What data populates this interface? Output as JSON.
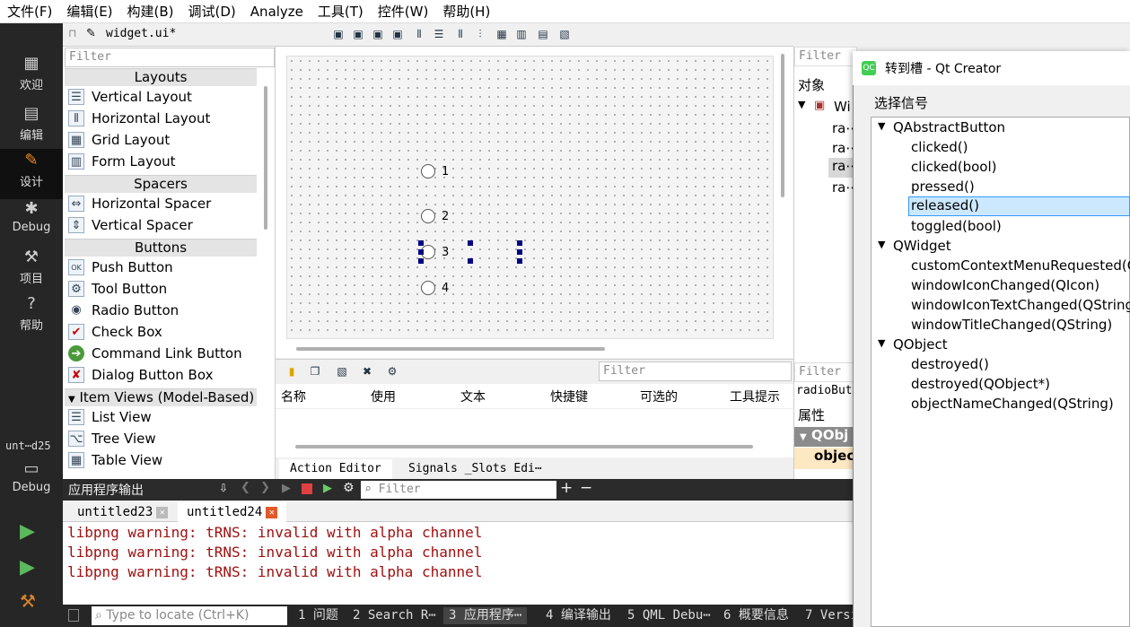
{
  "menubar": [
    "文件(F)",
    "编辑(E)",
    "构建(B)",
    "调试(D)",
    "Analyze",
    "工具(T)",
    "控件(W)",
    "帮助(H)"
  ],
  "modes": {
    "welcome": "欢迎",
    "edit": "编辑",
    "design": "设计",
    "debug": "Debug",
    "projects": "项目",
    "help": "帮助"
  },
  "kit": {
    "label": "unt⋯d25",
    "mode": "Debug"
  },
  "editor": {
    "file": "widget.ui*"
  },
  "widgetbox": {
    "filter": "Filter",
    "cat_layouts": "Layouts",
    "layouts": [
      "Vertical Layout",
      "Horizontal Layout",
      "Grid Layout",
      "Form Layout"
    ],
    "cat_spacers": "Spacers",
    "spacers": [
      "Horizontal Spacer",
      "Vertical Spacer"
    ],
    "cat_buttons": "Buttons",
    "buttons": [
      "Push Button",
      "Tool Button",
      "Radio Button",
      "Check Box",
      "Command Link Button",
      "Dialog Button Box"
    ],
    "cat_itemviews": "Item Views (Model-Based)",
    "itemviews": [
      "List View",
      "Tree View",
      "Table View"
    ]
  },
  "form": {
    "radios": [
      "1",
      "2",
      "3",
      "4"
    ]
  },
  "actions": {
    "filter": "Filter",
    "columns": [
      "名称",
      "使用",
      "文本",
      "快捷键",
      "可选的",
      "工具提示"
    ],
    "tab_action": "Action Editor",
    "tab_signals": "Signals _Slots Edi⋯"
  },
  "objinspector": {
    "filter": "Filter",
    "header": "对象",
    "root": "Wi",
    "children": [
      "ra⋯",
      "ra⋯",
      "ra⋯",
      "ra⋯"
    ]
  },
  "propeditor": {
    "filter": "Filter",
    "current": "radioButt",
    "header": "属性",
    "group": "QObj",
    "row": "object"
  },
  "output": {
    "title": "应用程序输出",
    "filter": "Filter",
    "tabs": [
      "untitled23",
      "untitled24"
    ],
    "lines": [
      "libpng warning: tRNS: invalid with alpha channel",
      "libpng warning: tRNS: invalid with alpha channel",
      "libpng warning: tRNS: invalid with alpha channel"
    ]
  },
  "statusbar": {
    "locate": "Type to locate (Ctrl+K)",
    "items": [
      "1 问题",
      "2 Search R⋯",
      "3 应用程序⋯",
      "4 编译输出",
      "5 QML Debu⋯",
      "6 概要信息",
      "7 Versi"
    ]
  },
  "dialog": {
    "title": "转到槽 - Qt Creator",
    "group": "选择信号",
    "classes": [
      {
        "name": "QAbstractButton",
        "signals": [
          "clicked()",
          "clicked(bool)",
          "pressed()",
          "released()",
          "toggled(bool)"
        ]
      },
      {
        "name": "QWidget",
        "signals": [
          "customContextMenuRequested(Q",
          "windowIconChanged(QIcon)",
          "windowIconTextChanged(QString)",
          "windowTitleChanged(QString)"
        ]
      },
      {
        "name": "QObject",
        "signals": [
          "destroyed()",
          "destroyed(QObject*)",
          "objectNameChanged(QString)"
        ]
      }
    ],
    "selected": "released()"
  },
  "colors": {
    "accent": "#f08a24",
    "log": "#a01010",
    "handle": "#000080",
    "selection": "#cce8ff"
  }
}
